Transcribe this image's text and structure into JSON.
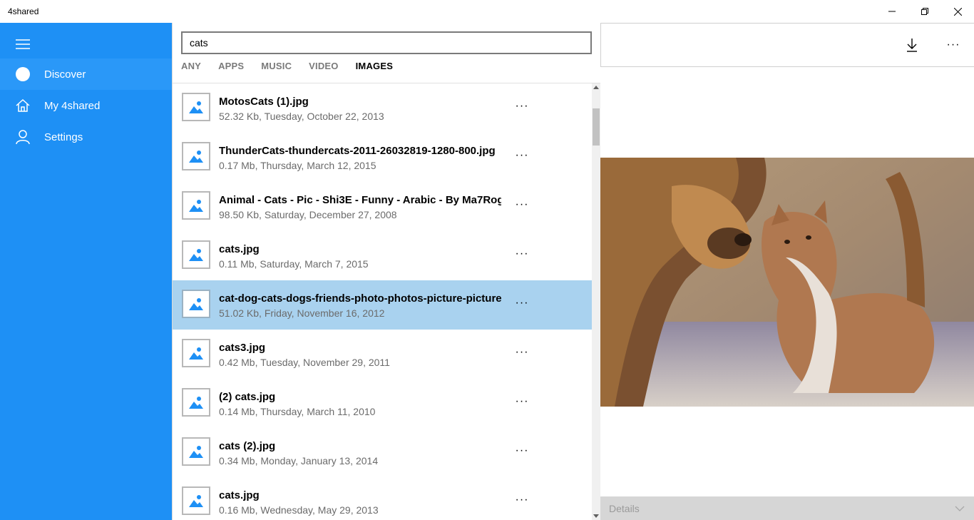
{
  "window": {
    "title": "4shared"
  },
  "sidebar": {
    "items": [
      {
        "label": "Discover"
      },
      {
        "label": "My 4shared"
      },
      {
        "label": "Settings"
      }
    ]
  },
  "search": {
    "query": "cats"
  },
  "filters": [
    "ANY",
    "APPS",
    "MUSIC",
    "VIDEO",
    "IMAGES"
  ],
  "active_filter": "IMAGES",
  "results": [
    {
      "name": "MotosCats (1).jpg",
      "meta": "52.32 Kb, Tuesday, October 22, 2013"
    },
    {
      "name": "ThunderCats-thundercats-2011-26032819-1280-800.jpg",
      "meta": "0.17 Mb, Thursday, March 12, 2015"
    },
    {
      "name": "Animal - Cats - Pic - Shi3E - Funny - Arabic - By Ma7Rog",
      "meta": "98.50 Kb, Saturday, December 27, 2008"
    },
    {
      "name": "cats.jpg",
      "meta": "0.11 Mb, Saturday, March 7, 2015"
    },
    {
      "name": "cat-dog-cats-dogs-friends-photo-photos-picture-pictures.jpg",
      "meta": "51.02 Kb, Friday, November 16, 2012"
    },
    {
      "name": "cats3.jpg",
      "meta": "0.42 Mb, Tuesday, November 29, 2011"
    },
    {
      "name": "(2) cats.jpg",
      "meta": "0.14 Mb, Thursday, March 11, 2010"
    },
    {
      "name": "cats (2).jpg",
      "meta": "0.34 Mb, Monday, January 13, 2014"
    },
    {
      "name": "cats.jpg",
      "meta": "0.16 Mb, Wednesday, May 29, 2013"
    }
  ],
  "more_glyph": "···",
  "details": {
    "label": "Details"
  },
  "colors": {
    "accent": "#1e90f5",
    "selected_row": "#a9d2ef",
    "icon_blue": "#1e90f5"
  }
}
